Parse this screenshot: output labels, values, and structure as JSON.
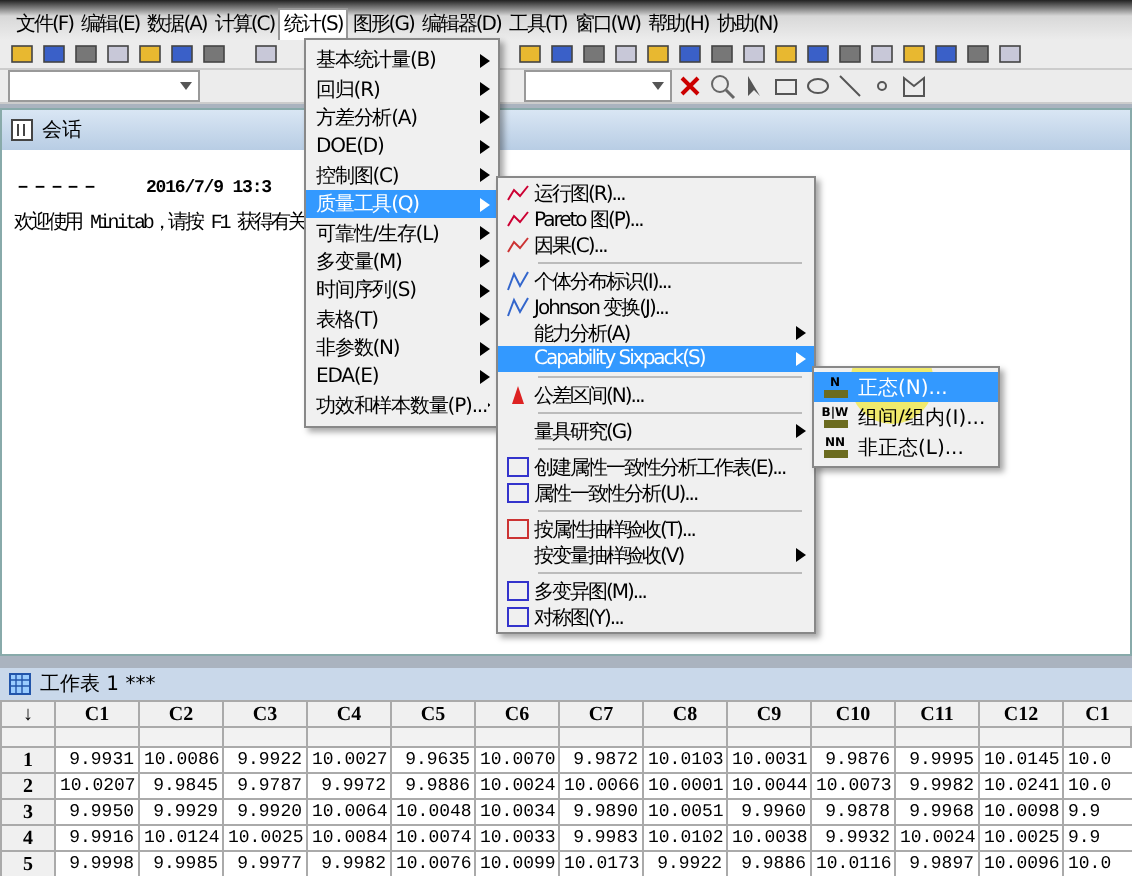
{
  "menubar": [
    {
      "label": "文件(F)",
      "selected": false
    },
    {
      "label": "编辑(E)",
      "selected": false
    },
    {
      "label": "数据(A)",
      "selected": false
    },
    {
      "label": "计算(C)",
      "selected": false
    },
    {
      "label": "统计(S)",
      "selected": true
    },
    {
      "label": "图形(G)",
      "selected": false
    },
    {
      "label": "编辑器(D)",
      "selected": false
    },
    {
      "label": "工具(T)",
      "selected": false
    },
    {
      "label": "窗口(W)",
      "selected": false
    },
    {
      "label": "帮助(H)",
      "selected": false
    },
    {
      "label": "协助(N)",
      "selected": false
    }
  ],
  "stat_menu": [
    {
      "label": "基本统计量(B)",
      "selected": false
    },
    {
      "label": "回归(R)",
      "selected": false
    },
    {
      "label": "方差分析(A)",
      "selected": false
    },
    {
      "label": "DOE(D)",
      "selected": false
    },
    {
      "label": "控制图(C)",
      "selected": false
    },
    {
      "label": "质量工具(Q)",
      "selected": true
    },
    {
      "label": "可靠性/生存(L)",
      "selected": false
    },
    {
      "label": "多变量(M)",
      "selected": false
    },
    {
      "label": "时间序列(S)",
      "selected": false
    },
    {
      "label": "表格(T)",
      "selected": false
    },
    {
      "label": "非参数(N)",
      "selected": false
    },
    {
      "label": "EDA(E)",
      "selected": false
    },
    {
      "label": "功效和样本数量(P)...",
      "selected": false
    }
  ],
  "quality_menu": [
    {
      "kind": "item",
      "label": "运行图(R)...",
      "submenu": false,
      "selected": false
    },
    {
      "kind": "item",
      "label": "Pareto 图(P)...",
      "submenu": false,
      "selected": false
    },
    {
      "kind": "item",
      "label": "因果(C)...",
      "submenu": false,
      "selected": false
    },
    {
      "kind": "separator"
    },
    {
      "kind": "item",
      "label": "个体分布标识(I)...",
      "submenu": false,
      "selected": false
    },
    {
      "kind": "item",
      "label": "Johnson 变换(J)...",
      "submenu": false,
      "selected": false
    },
    {
      "kind": "item",
      "label": "能力分析(A)",
      "submenu": true,
      "selected": false
    },
    {
      "kind": "item",
      "label": "Capability Sixpack(S)",
      "submenu": true,
      "selected": true
    },
    {
      "kind": "separator"
    },
    {
      "kind": "item",
      "label": "公差区间(N)...",
      "submenu": false,
      "selected": false
    },
    {
      "kind": "separator"
    },
    {
      "kind": "item",
      "label": "量具研究(G)",
      "submenu": true,
      "selected": false
    },
    {
      "kind": "separator"
    },
    {
      "kind": "item",
      "label": "创建属性一致性分析工作表(E)...",
      "submenu": false,
      "selected": false
    },
    {
      "kind": "item",
      "label": "属性一致性分析(U)...",
      "submenu": false,
      "selected": false
    },
    {
      "kind": "separator"
    },
    {
      "kind": "item",
      "label": "按属性抽样验收(T)...",
      "submenu": false,
      "selected": false
    },
    {
      "kind": "item",
      "label": "按变量抽样验收(V)",
      "submenu": true,
      "selected": false
    },
    {
      "kind": "separator"
    },
    {
      "kind": "item",
      "label": "多变异图(M)...",
      "submenu": false,
      "selected": false
    },
    {
      "kind": "item",
      "label": "对称图(Y)...",
      "submenu": false,
      "selected": false
    }
  ],
  "sixpack_menu": [
    {
      "label": "正态(N)...",
      "icon_text": "N",
      "selected": true
    },
    {
      "label": "组间/组内(I)...",
      "icon_text": "B|W",
      "selected": false
    },
    {
      "label": "非正态(L)...",
      "icon_text": "NN",
      "selected": false
    }
  ],
  "session": {
    "title": "会话",
    "lines": [
      {
        "text": "－－－－－     2016/7/9 13:3",
        "bold": true
      },
      {
        "text": "欢迎使用 Minitab，请按 F1 获得有关",
        "bold": false
      }
    ]
  },
  "worksheet": {
    "title": "工作表 1 ***",
    "corner": "↓",
    "columns": [
      "C1",
      "C2",
      "C3",
      "C4",
      "C5",
      "C6",
      "C7",
      "C8",
      "C9",
      "C10",
      "C11",
      "C12",
      "C1"
    ],
    "rows": [
      {
        "label": "1",
        "cells": [
          "9.9931",
          "10.0086",
          "9.9922",
          "10.0027",
          "9.9635",
          "10.0070",
          "9.9872",
          "10.0103",
          "10.0031",
          "9.9876",
          "9.9995",
          "10.0145",
          "10.0"
        ]
      },
      {
        "label": "2",
        "cells": [
          "10.0207",
          "9.9845",
          "9.9787",
          "9.9972",
          "9.9886",
          "10.0024",
          "10.0066",
          "10.0001",
          "10.0044",
          "10.0073",
          "9.9982",
          "10.0241",
          "10.0"
        ]
      },
      {
        "label": "3",
        "cells": [
          "9.9950",
          "9.9929",
          "9.9920",
          "10.0064",
          "10.0048",
          "10.0034",
          "9.9890",
          "10.0051",
          "9.9960",
          "9.9878",
          "9.9968",
          "10.0098",
          "9.9"
        ]
      },
      {
        "label": "4",
        "cells": [
          "9.9916",
          "10.0124",
          "10.0025",
          "10.0084",
          "10.0074",
          "10.0033",
          "9.9983",
          "10.0102",
          "10.0038",
          "9.9932",
          "10.0024",
          "10.0025",
          "9.9"
        ]
      },
      {
        "label": "5",
        "cells": [
          "9.9998",
          "9.9985",
          "9.9977",
          "9.9982",
          "10.0076",
          "10.0099",
          "10.0173",
          "9.9922",
          "9.9886",
          "10.0116",
          "9.9897",
          "10.0096",
          "10.0"
        ]
      }
    ]
  }
}
